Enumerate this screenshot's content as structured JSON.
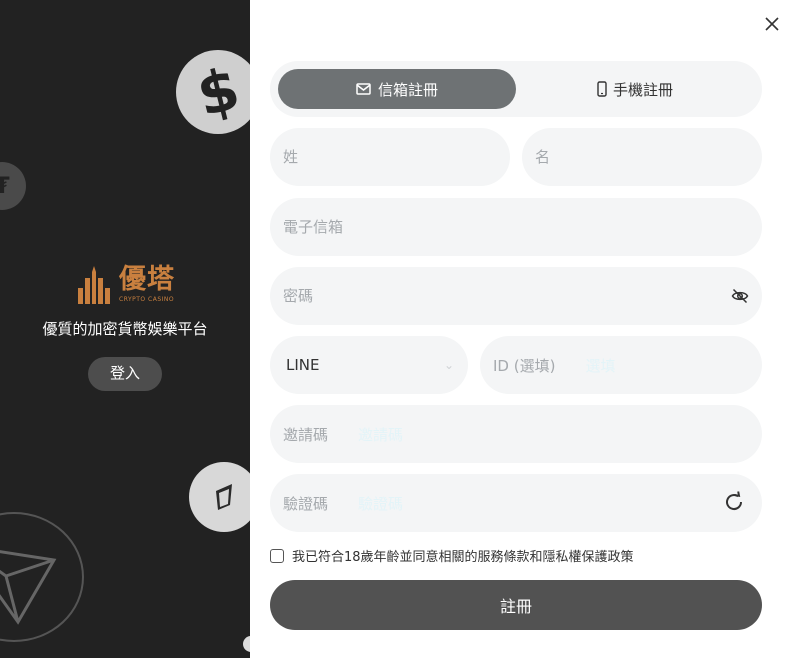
{
  "brand": {
    "logo_title": "優塔",
    "logo_subtitle": "CRYPTO CASINO",
    "tagline": "優質的加密貨幣娛樂平台",
    "login_label": "登入"
  },
  "tabs": [
    {
      "label": "信箱註冊",
      "icon": "mail-icon",
      "active": true
    },
    {
      "label": "手機註冊",
      "icon": "phone-icon",
      "active": false
    }
  ],
  "form": {
    "last_name_placeholder": "姓",
    "first_name_placeholder": "名",
    "email_placeholder": "電子信箱",
    "password_placeholder": "密碼",
    "social_type_value": "LINE",
    "social_id_placeholder": "ID (選填)",
    "social_id_hint": "選填",
    "invite_label": "邀請碼",
    "invite_hint": "邀請碼",
    "verify_label": "驗證碼",
    "verify_hint": "驗證碼",
    "agree_text": "我已符合18歲年齡並同意相關的服務條款和隱私權保護政策",
    "submit_label": "註冊"
  },
  "colors": {
    "left_bg": "#222222",
    "brand_accent": "#c9803f",
    "active_tab": "#6e7274",
    "field_bg": "#f4f5f6",
    "submit_bg": "#525252"
  }
}
